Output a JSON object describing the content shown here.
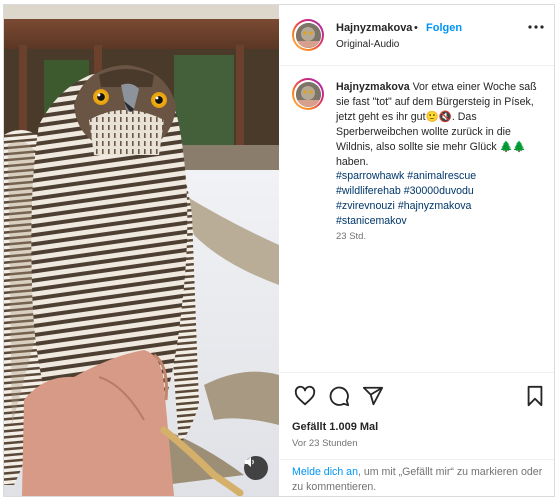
{
  "post": {
    "username": "Hajnyzmakova",
    "dot": "•",
    "follow_label": "Folgen",
    "audio_label": "Original-Audio",
    "caption_username": "Hajnyzmakova",
    "caption_text": "Vor etwa einer Woche saß sie fast \"tot\" auf dem Bürgersteig in Písek, jetzt geht es ihr gut🙂🔇. Das Sperberweibchen wollte zurück in die Wildnis, also sollte sie mehr Glück 🌲🌲 haben.",
    "hashtags": [
      "#sparrowhawk #animalrescue",
      "#wildliferehab #30000duvodu",
      "#zvirevnouzi #hajnyzmakova",
      "#stanicemakov"
    ],
    "caption_time": "23 Std.",
    "likes": "Gefällt 1.009 Mal",
    "time_ago": "Vor 23 Stunden"
  },
  "login_prompt": {
    "link_text": "Melde dich an",
    "rest_text": ", um mit „Gefällt mir“ zu markieren oder zu kommentieren."
  },
  "icons": {
    "more": "more-options-icon",
    "like": "heart-icon",
    "comment": "comment-icon",
    "share": "paper-plane-icon",
    "save": "bookmark-icon",
    "audio": "speaker-muted-icon"
  },
  "colors": {
    "link_blue": "#0095f6",
    "hashtag": "#00376b",
    "muted_text": "#737373",
    "border": "#dbdbdb"
  }
}
